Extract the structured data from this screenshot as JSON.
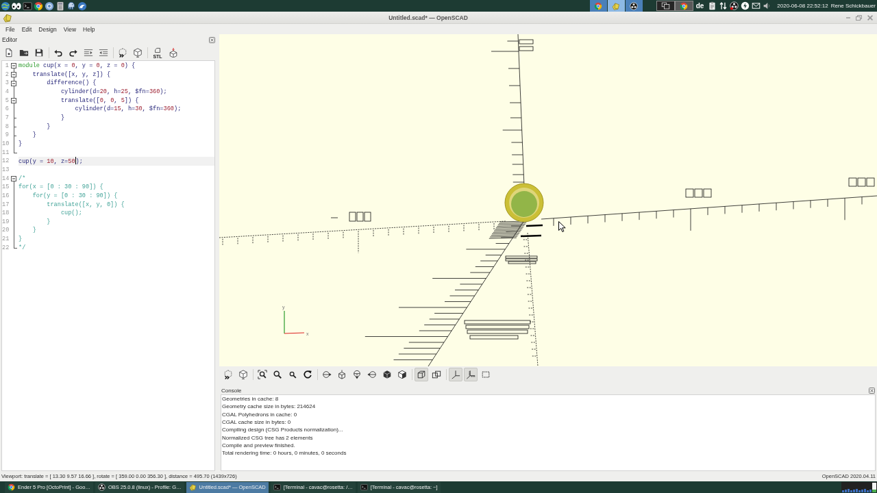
{
  "top_panel": {
    "tasks": [
      {
        "kind": "browser",
        "selected": false
      },
      {
        "kind": "cad",
        "selected": true
      },
      {
        "kind": "recorder",
        "selected": false
      }
    ],
    "keyboard_layout": "de",
    "clock": "2020-06-08 22:52:12",
    "user": "Rene Schickbauer"
  },
  "window": {
    "title": "Untitled.scad* — OpenSCAD"
  },
  "menu": [
    "File",
    "Edit",
    "Design",
    "View",
    "Help"
  ],
  "editor": {
    "title": "Editor",
    "export_label": "STL",
    "lines": [
      {
        "number": "1",
        "fold": {
          "kind": "start"
        },
        "current": false,
        "tokens": [
          {
            "kind": "keyword",
            "text": "module"
          },
          {
            "kind": "plain",
            "text": " cup(x = "
          },
          {
            "kind": "number",
            "text": "0"
          },
          {
            "kind": "plain",
            "text": ", y = "
          },
          {
            "kind": "number",
            "text": "0"
          },
          {
            "kind": "plain",
            "text": ", z = "
          },
          {
            "kind": "number",
            "text": "0"
          },
          {
            "kind": "plain",
            "text": ") {"
          }
        ]
      },
      {
        "number": "2",
        "fold": {
          "kind": "branch"
        },
        "current": false,
        "tokens": [
          {
            "kind": "plain",
            "text": "    translate([x, y, z]) {"
          }
        ]
      },
      {
        "number": "3",
        "fold": {
          "kind": "branch"
        },
        "current": false,
        "tokens": [
          {
            "kind": "plain",
            "text": "        difference() {"
          }
        ]
      },
      {
        "number": "4",
        "fold": {
          "kind": "line"
        },
        "current": false,
        "tokens": [
          {
            "kind": "plain",
            "text": "            cylinder(d="
          },
          {
            "kind": "number",
            "text": "20"
          },
          {
            "kind": "plain",
            "text": ", h="
          },
          {
            "kind": "number",
            "text": "25"
          },
          {
            "kind": "plain",
            "text": ", $fn="
          },
          {
            "kind": "number",
            "text": "360"
          },
          {
            "kind": "plain",
            "text": ");"
          }
        ]
      },
      {
        "number": "5",
        "fold": {
          "kind": "branch"
        },
        "current": false,
        "tokens": [
          {
            "kind": "plain",
            "text": "            translate(["
          },
          {
            "kind": "number",
            "text": "0"
          },
          {
            "kind": "plain",
            "text": ", "
          },
          {
            "kind": "number",
            "text": "0"
          },
          {
            "kind": "plain",
            "text": ", "
          },
          {
            "kind": "number",
            "text": "5"
          },
          {
            "kind": "plain",
            "text": "]) {"
          }
        ]
      },
      {
        "number": "6",
        "fold": {
          "kind": "line"
        },
        "current": false,
        "tokens": [
          {
            "kind": "plain",
            "text": "                cylinder(d="
          },
          {
            "kind": "number",
            "text": "15"
          },
          {
            "kind": "plain",
            "text": ", h="
          },
          {
            "kind": "number",
            "text": "30"
          },
          {
            "kind": "plain",
            "text": ", $fn="
          },
          {
            "kind": "number",
            "text": "360"
          },
          {
            "kind": "plain",
            "text": ");"
          }
        ]
      },
      {
        "number": "7",
        "fold": {
          "kind": "tick"
        },
        "current": false,
        "tokens": [
          {
            "kind": "plain",
            "text": "            }"
          }
        ]
      },
      {
        "number": "8",
        "fold": {
          "kind": "tick"
        },
        "current": false,
        "tokens": [
          {
            "kind": "plain",
            "text": "        }"
          }
        ]
      },
      {
        "number": "9",
        "fold": {
          "kind": "tick"
        },
        "current": false,
        "tokens": [
          {
            "kind": "plain",
            "text": "    }"
          }
        ]
      },
      {
        "number": "10",
        "fold": {
          "kind": "line"
        },
        "current": false,
        "tokens": [
          {
            "kind": "plain",
            "text": "}"
          }
        ]
      },
      {
        "number": "11",
        "fold": {
          "kind": "end"
        },
        "current": false
      },
      {
        "number": "12",
        "current": true,
        "tokens": [
          {
            "kind": "plain",
            "text": "cup(y = "
          },
          {
            "kind": "number",
            "text": "10"
          },
          {
            "kind": "plain",
            "text": ", z="
          },
          {
            "kind": "number",
            "text": "50"
          },
          {
            "kind": "caret"
          },
          {
            "kind": "plain",
            "text": ");"
          }
        ]
      },
      {
        "number": "13",
        "current": false
      },
      {
        "number": "14",
        "fold": {
          "kind": "start"
        },
        "current": false,
        "tokens": [
          {
            "kind": "comment",
            "text": "/*"
          }
        ]
      },
      {
        "number": "15",
        "fold": {
          "kind": "line"
        },
        "current": false,
        "tokens": [
          {
            "kind": "comment",
            "text": "for(x = [0 : 30 : 90]) {"
          }
        ]
      },
      {
        "number": "16",
        "fold": {
          "kind": "line"
        },
        "current": false,
        "tokens": [
          {
            "kind": "comment",
            "text": "    for(y = [0 : 30 : 90]) {"
          }
        ]
      },
      {
        "number": "17",
        "fold": {
          "kind": "line"
        },
        "current": false,
        "tokens": [
          {
            "kind": "comment",
            "text": "        translate([x, y, 0]) {"
          }
        ]
      },
      {
        "number": "18",
        "fold": {
          "kind": "line"
        },
        "current": false,
        "tokens": [
          {
            "kind": "comment",
            "text": "            cup();"
          }
        ]
      },
      {
        "number": "19",
        "fold": {
          "kind": "line"
        },
        "current": false,
        "tokens": [
          {
            "kind": "comment",
            "text": "        }"
          }
        ]
      },
      {
        "number": "20",
        "fold": {
          "kind": "line"
        },
        "current": false,
        "tokens": [
          {
            "kind": "comment",
            "text": "    }"
          }
        ]
      },
      {
        "number": "21",
        "fold": {
          "kind": "line"
        },
        "current": false,
        "tokens": [
          {
            "kind": "comment",
            "text": "}"
          }
        ]
      },
      {
        "number": "22",
        "fold": {
          "kind": "end"
        },
        "current": false,
        "tokens": [
          {
            "kind": "comment",
            "text": "*/"
          }
        ]
      }
    ]
  },
  "viewport": {
    "axis_labels": [
      "y",
      "x"
    ]
  },
  "viewport_toolbar": {
    "projection": [
      {
        "selected": true
      },
      {
        "selected": false
      }
    ],
    "toggles": [
      {
        "on": true
      },
      {
        "on": true
      },
      {
        "on": false
      }
    ]
  },
  "console": {
    "title": "Console",
    "lines": [
      "Geometries in cache: 8",
      "Geometry cache size in bytes: 214624",
      "CGAL Polyhedrons in cache: 0",
      "CGAL cache size in bytes: 0",
      "Compiling design (CSG Products normalization)...",
      "Normalized CSG tree has 2 elements",
      "Compile and preview finished.",
      "Total rendering time: 0 hours, 0 minutes, 0 seconds"
    ]
  },
  "status_bar": {
    "viewport": "Viewport: translate = [ 13.30 9.57 16.66 ], rotate = [ 359.00 0.00 356.30 ], distance = 495.70 (1439x726)",
    "version": "OpenSCAD 2020.04.11"
  },
  "taskbar": [
    {
      "kind": "browser",
      "label": "Ender 5 Pro [OctoPrint] - Goo…",
      "selected": false
    },
    {
      "kind": "recorder",
      "label": "OBS 25.0.8 (linux) - Profile: G…",
      "selected": false
    },
    {
      "kind": "cad",
      "label": "Untitled.scad* — OpenSCAD",
      "selected": true
    },
    {
      "kind": "terminal",
      "label": "[Terminal - cavac@rosetta: /…",
      "selected": false
    },
    {
      "kind": "terminal",
      "label": "[Terminal - cavac@rosetta: ~]",
      "selected": false
    }
  ]
}
